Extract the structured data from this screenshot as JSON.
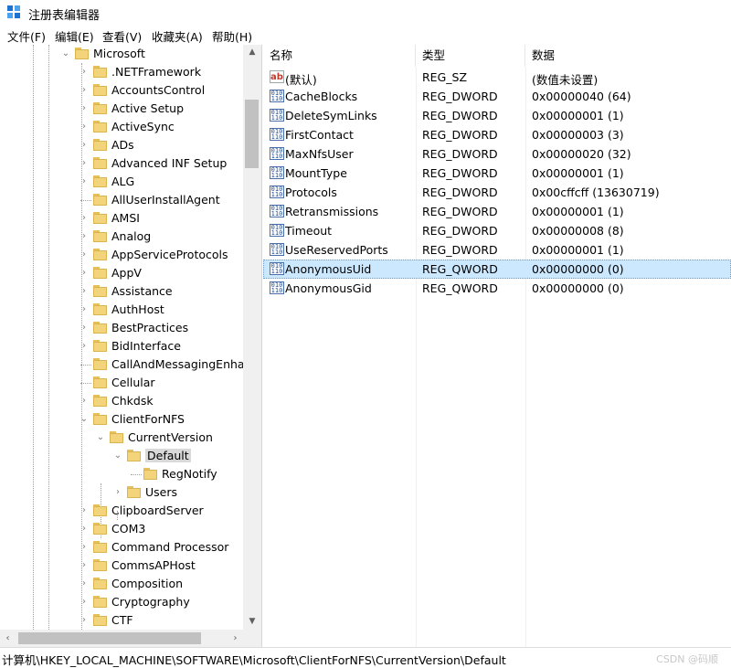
{
  "window": {
    "title": "注册表编辑器"
  },
  "menu": [
    "文件(F)",
    "编辑(E)",
    "查看(V)",
    "收藏夹(A)",
    "帮助(H)"
  ],
  "tree": [
    {
      "label": "Microsoft",
      "expanded": true
    },
    {
      "label": ".NETFramework"
    },
    {
      "label": "AccountsControl"
    },
    {
      "label": "Active Setup"
    },
    {
      "label": "ActiveSync"
    },
    {
      "label": "ADs"
    },
    {
      "label": "Advanced INF Setup"
    },
    {
      "label": "ALG"
    },
    {
      "label": "AllUserInstallAgent"
    },
    {
      "label": "AMSI"
    },
    {
      "label": "Analog"
    },
    {
      "label": "AppServiceProtocols"
    },
    {
      "label": "AppV"
    },
    {
      "label": "Assistance"
    },
    {
      "label": "AuthHost"
    },
    {
      "label": "BestPractices"
    },
    {
      "label": "BidInterface"
    },
    {
      "label": "CallAndMessagingEnhan"
    },
    {
      "label": "Cellular"
    },
    {
      "label": "Chkdsk"
    },
    {
      "label": "ClientForNFS",
      "expanded": true
    },
    {
      "label": "CurrentVersion",
      "expanded": true
    },
    {
      "label": "Default",
      "expanded": true,
      "selected": true
    },
    {
      "label": "RegNotify"
    },
    {
      "label": "Users"
    },
    {
      "label": "ClipboardServer"
    },
    {
      "label": "COM3"
    },
    {
      "label": "Command Processor"
    },
    {
      "label": "CommsAPHost"
    },
    {
      "label": "Composition"
    },
    {
      "label": "Cryptography"
    },
    {
      "label": "CTF"
    }
  ],
  "columns": {
    "name": "名称",
    "type": "类型",
    "data": "数据"
  },
  "values": [
    {
      "name": "(默认)",
      "type": "REG_SZ",
      "data": "(数值未设置)",
      "icon": "string-value-icon"
    },
    {
      "name": "CacheBlocks",
      "type": "REG_DWORD",
      "data": "0x00000040 (64)",
      "icon": "binary-value-icon"
    },
    {
      "name": "DeleteSymLinks",
      "type": "REG_DWORD",
      "data": "0x00000001 (1)",
      "icon": "binary-value-icon"
    },
    {
      "name": "FirstContact",
      "type": "REG_DWORD",
      "data": "0x00000003 (3)",
      "icon": "binary-value-icon"
    },
    {
      "name": "MaxNfsUser",
      "type": "REG_DWORD",
      "data": "0x00000020 (32)",
      "icon": "binary-value-icon"
    },
    {
      "name": "MountType",
      "type": "REG_DWORD",
      "data": "0x00000001 (1)",
      "icon": "binary-value-icon"
    },
    {
      "name": "Protocols",
      "type": "REG_DWORD",
      "data": "0x00cffcff (13630719)",
      "icon": "binary-value-icon"
    },
    {
      "name": "Retransmissions",
      "type": "REG_DWORD",
      "data": "0x00000001 (1)",
      "icon": "binary-value-icon"
    },
    {
      "name": "Timeout",
      "type": "REG_DWORD",
      "data": "0x00000008 (8)",
      "icon": "binary-value-icon"
    },
    {
      "name": "UseReservedPorts",
      "type": "REG_DWORD",
      "data": "0x00000001 (1)",
      "icon": "binary-value-icon"
    },
    {
      "name": "AnonymousUid",
      "type": "REG_QWORD",
      "data": "0x00000000 (0)",
      "icon": "binary-value-icon",
      "selected": true
    },
    {
      "name": "AnonymousGid",
      "type": "REG_QWORD",
      "data": "0x00000000 (0)",
      "icon": "binary-value-icon"
    }
  ],
  "status": {
    "path": "计算机\\HKEY_LOCAL_MACHINE\\SOFTWARE\\Microsoft\\ClientForNFS\\CurrentVersion\\Default",
    "watermark": "CSDN @码顺"
  }
}
